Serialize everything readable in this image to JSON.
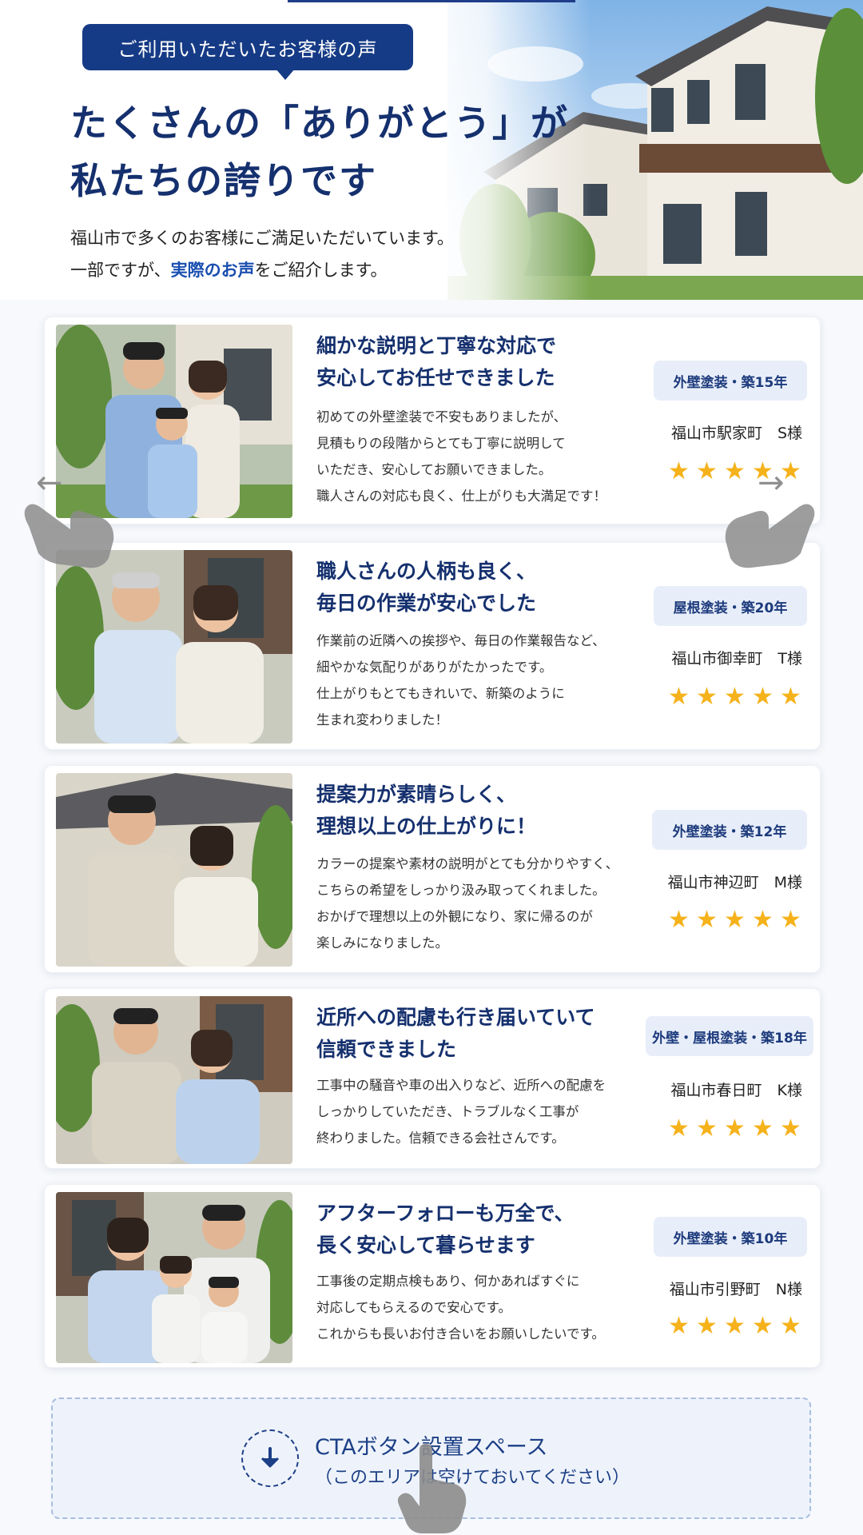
{
  "hero": {
    "badge": "ご利用いただいたお客様の声",
    "title_line1": "たくさんの「ありがとう」が",
    "title_line2": "私たちの誇りです",
    "sub_line1": "福山市で多くのお客様にご満足いただいています。",
    "sub_line2_pre": "一部ですが、",
    "sub_line2_highlight": "実際のお声",
    "sub_line2_post": "をご紹介します。"
  },
  "reviews": [
    {
      "title1": "細かな説明と丁寧な対応で",
      "title2": "安心してお任せできました",
      "body": [
        "初めての外壁塗装で不安もありましたが、",
        "見積もりの段階からとても丁寧に説明して",
        "いただき、安心してお願いできました。",
        "職人さんの対応も良く、仕上がりも大満足です！"
      ],
      "tag": "外壁塗装・築15年",
      "location": "福山市駅家町　S様",
      "rating": 5
    },
    {
      "title1": "職人さんの人柄も良く、",
      "title2": "毎日の作業が安心でした",
      "body": [
        "作業前の近隣への挨拶や、毎日の作業報告など、",
        "細やかな気配りがありがたかったです。",
        "仕上がりもとてもきれいで、新築のように",
        "生まれ変わりました！"
      ],
      "tag": "屋根塗装・築20年",
      "location": "福山市御幸町　T様",
      "rating": 5
    },
    {
      "title1": "提案力が素晴らしく、",
      "title2": "理想以上の仕上がりに！",
      "body": [
        "カラーの提案や素材の説明がとても分かりやすく、",
        "こちらの希望をしっかり汲み取ってくれました。",
        "おかげで理想以上の外観になり、家に帰るのが",
        "楽しみになりました。"
      ],
      "tag": "外壁塗装・築12年",
      "location": "福山市神辺町　M様",
      "rating": 5
    },
    {
      "title1": "近所への配慮も行き届いていて",
      "title2": "信頼できました",
      "body": [
        "工事中の騒音や車の出入りなど、近所への配慮を",
        "しっかりしていただき、トラブルなく工事が",
        "終わりました。信頼できる会社さんです。"
      ],
      "tag": "外壁・屋根塗装・築18年",
      "location": "福山市春日町　K様",
      "rating": 5
    },
    {
      "title1": "アフターフォローも万全で、",
      "title2": "長く安心して暮らせます",
      "body": [
        "工事後の定期点検もあり、何かあればすぐに",
        "対応してもらえるので安心です。",
        "これからも長いお付き合いをお願いしたいです。"
      ],
      "tag": "外壁塗装・築10年",
      "location": "福山市引野町　N様",
      "rating": 5
    }
  ],
  "cta": {
    "title": "CTAボタン設置スペース",
    "subtitle": "（このエリアは空けておいてください）"
  },
  "icons": {
    "star": "star-icon",
    "cta": "arrow-down-circle-icon",
    "swipe_left": "arrow-left-icon",
    "swipe_right": "arrow-right-icon",
    "hand": "pointing-hand-icon"
  },
  "colors": {
    "navy": "#15306e",
    "badge": "#163b86",
    "star": "#f5b21b",
    "tag_bg": "#e8eef9"
  }
}
